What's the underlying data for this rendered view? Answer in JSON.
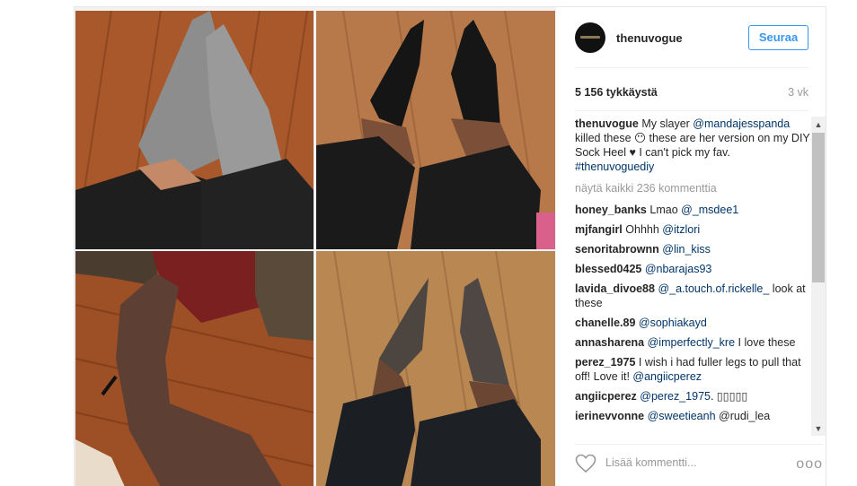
{
  "post": {
    "username": "thenuvogue",
    "follow_label": "Seuraa",
    "likes": "5 156 tykkäystä",
    "age": "3 vk",
    "caption": {
      "user": "thenuvogue",
      "part1": "My slayer ",
      "mention": "@mandajesspanda",
      "part2": " killed these 😶 these are her version on my DIY Sock Heel ♥ I can't pick my fav. ",
      "hashtag": "#thenuvoguediy"
    },
    "view_all": "näytä kaikki 236 kommenttia",
    "comments": [
      {
        "user": "honey_banks",
        "before": "Lmao ",
        "mention": "@_msdee1",
        "after": ""
      },
      {
        "user": "mjfangirl",
        "before": "Ohhhh ",
        "mention": "@itzlori",
        "after": ""
      },
      {
        "user": "senoritabrownn",
        "before": "",
        "mention": "@lin_kiss",
        "after": ""
      },
      {
        "user": "blessed0425",
        "before": "",
        "mention": "@nbarajas93",
        "after": ""
      },
      {
        "user": "lavida_divoe88",
        "before": "",
        "mention": "@_a.touch.of.rickelle_",
        "after": " look at these"
      },
      {
        "user": "chanelle.89",
        "before": "",
        "mention": "@sophiakayd",
        "after": ""
      },
      {
        "user": "annasharena",
        "before": "",
        "mention": "@imperfectly_kre",
        "after": " I love these"
      },
      {
        "user": "perez_1975",
        "before": "I wish i had fuller legs to pull that off! Love it! ",
        "mention": "@angiicperez",
        "after": ""
      },
      {
        "user": "angiicperez",
        "before": "",
        "mention": "@perez_1975",
        "after": ". ▯▯▯▯▯"
      },
      {
        "user": "ierinevvonne",
        "before": "",
        "mention": "@sweetieanh",
        "after": " @rudi_lea"
      }
    ],
    "add_comment_placeholder": "Lisää kommentti...",
    "more_label": "ooo",
    "icons": {
      "like": "heart-icon",
      "more": "more-options-icon",
      "scroll_up": "arrow-up-icon",
      "scroll_down": "arrow-down-icon"
    }
  }
}
